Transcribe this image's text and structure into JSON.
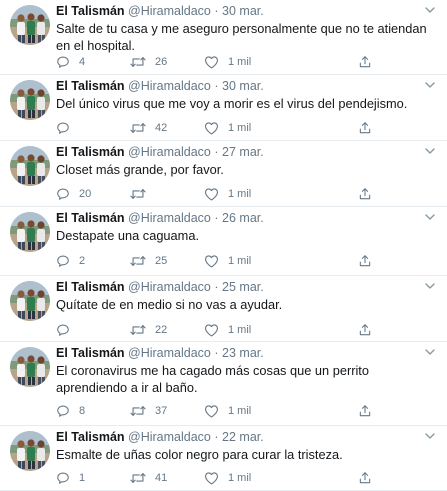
{
  "author": {
    "name": "El Talismán",
    "handle": "@Hiramaldaco",
    "separator": "·",
    "avatar_icon": "avatar-photo-icon"
  },
  "colors": {
    "text": "#14171a",
    "secondary": "#657786",
    "border": "#e6ecf0"
  },
  "tweets": [
    {
      "date": "30 mar.",
      "text": "Salte de tu casa y me aseguro personalmente que no te atiendan en el hospital.",
      "replies": "4",
      "retweets": "26",
      "likes": "1 mil"
    },
    {
      "date": "30 mar.",
      "text": "Del único virus que me voy a morir es el virus del pendejismo.",
      "replies": "",
      "retweets": "42",
      "likes": "1 mil"
    },
    {
      "date": "27 mar.",
      "text": "Closet más grande, por favor.",
      "replies": "20",
      "retweets": "",
      "likes": "1 mil"
    },
    {
      "date": "26 mar.",
      "text": "Destapate una caguama.",
      "replies": "2",
      "retweets": "25",
      "likes": "1 mil"
    },
    {
      "date": "25 mar.",
      "text": "Quítate de en medio si no vas a ayudar.",
      "replies": "",
      "retweets": "22",
      "likes": "1 mil"
    },
    {
      "date": "23 mar.",
      "text": "El coronavirus me ha cagado más cosas que un perrito aprendiendo a ir al baño.",
      "replies": "8",
      "retweets": "37",
      "likes": "1 mil"
    },
    {
      "date": "22 mar.",
      "text": "Esmalte de uñas color negro para curar la tristeza.",
      "replies": "1",
      "retweets": "41",
      "likes": "1 mil"
    }
  ]
}
